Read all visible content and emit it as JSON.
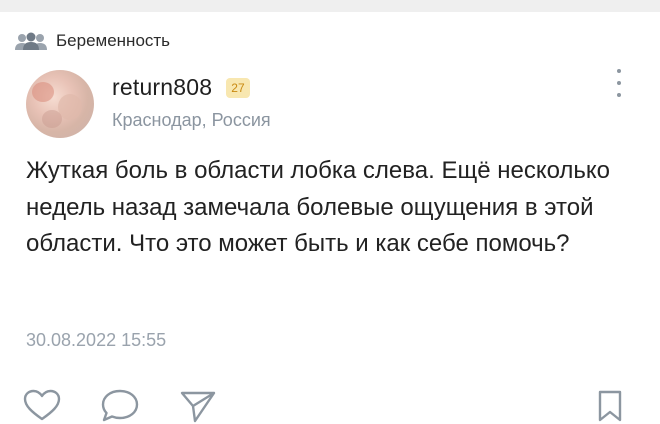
{
  "community": {
    "name": "Беременность",
    "icon": "group-icon"
  },
  "post": {
    "author": {
      "username": "return808",
      "badge": "27",
      "location": "Краснодар, Россия",
      "avatar": "avatar"
    },
    "text": "Жуткая боль в области лобка слева. Ещё несколько недель назад замечала болевые ощущения в этой области. Что это может быть и как себе помочь?",
    "timestamp": "30.08.2022 15:55"
  },
  "actions": {
    "like_icon": "heart-icon",
    "comment_icon": "comment-icon",
    "share_icon": "send-icon",
    "bookmark_icon": "bookmark-icon",
    "more_icon": "more-vertical-icon"
  },
  "colors": {
    "badge_bg": "#f8e7b0",
    "badge_text": "#c98a12",
    "muted_text": "#8b95a0",
    "icon_gray": "#8c96a0"
  }
}
